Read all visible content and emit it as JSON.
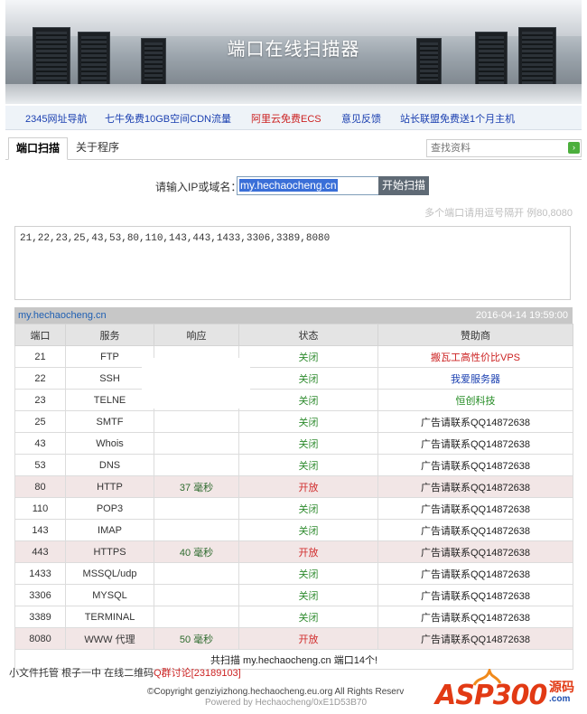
{
  "banner": {
    "title": "端口在线扫描器"
  },
  "links": [
    {
      "text": "2345网址导航",
      "color": "#1a3fb0"
    },
    {
      "text": "七牛免费10GB空间CDN流量",
      "color": "#1a3fb0"
    },
    {
      "text": "阿里云免费ECS",
      "color": "#cc2222"
    },
    {
      "text": "意见反馈",
      "color": "#1a3fb0"
    },
    {
      "text": "站长联盟免费送1个月主机",
      "color": "#1a3fb0"
    }
  ],
  "tabs": [
    {
      "label": "端口扫描",
      "active": true
    },
    {
      "label": "关于程序",
      "active": false
    }
  ],
  "search": {
    "placeholder": "查找资料"
  },
  "form": {
    "label": "请输入IP或域名：",
    "value": "my.hechaocheng.cn",
    "button": "开始扫描",
    "hint": "多个端口请用逗号隔开 例80,8080",
    "ports": "21,22,23,25,43,53,80,110,143,443,1433,3306,3389,8080"
  },
  "results": {
    "host": "my.hechaocheng.cn",
    "time": "2016-04-14 19:59:00",
    "headers": [
      "端口",
      "服务",
      "响应",
      "状态",
      "赞助商"
    ],
    "rows": [
      {
        "port": "21",
        "service": "FTP",
        "resp": "",
        "status": "关闭",
        "open": false,
        "sponsor": "搬瓦工高性价比VPS",
        "sponsor_class": "sp-red"
      },
      {
        "port": "22",
        "service": "SSH",
        "resp": "",
        "status": "关闭",
        "open": false,
        "sponsor": "我爱服务器",
        "sponsor_class": "sp-blue"
      },
      {
        "port": "23",
        "service": "TELNE",
        "resp": "",
        "status": "关闭",
        "open": false,
        "sponsor": "恒创科技",
        "sponsor_class": "sp-green"
      },
      {
        "port": "25",
        "service": "SMTF",
        "resp": "",
        "status": "关闭",
        "open": false,
        "sponsor": "广告请联系QQ14872638",
        "sponsor_class": "sp-dark"
      },
      {
        "port": "43",
        "service": "Whois",
        "resp": "",
        "status": "关闭",
        "open": false,
        "sponsor": "广告请联系QQ14872638",
        "sponsor_class": "sp-dark"
      },
      {
        "port": "53",
        "service": "DNS",
        "resp": "",
        "status": "关闭",
        "open": false,
        "sponsor": "广告请联系QQ14872638",
        "sponsor_class": "sp-dark"
      },
      {
        "port": "80",
        "service": "HTTP",
        "resp": "37 毫秒",
        "status": "开放",
        "open": true,
        "sponsor": "广告请联系QQ14872638",
        "sponsor_class": "sp-dark"
      },
      {
        "port": "110",
        "service": "POP3",
        "resp": "",
        "status": "关闭",
        "open": false,
        "sponsor": "广告请联系QQ14872638",
        "sponsor_class": "sp-dark"
      },
      {
        "port": "143",
        "service": "IMAP",
        "resp": "",
        "status": "关闭",
        "open": false,
        "sponsor": "广告请联系QQ14872638",
        "sponsor_class": "sp-dark"
      },
      {
        "port": "443",
        "service": "HTTPS",
        "resp": "40 毫秒",
        "status": "开放",
        "open": true,
        "sponsor": "广告请联系QQ14872638",
        "sponsor_class": "sp-dark"
      },
      {
        "port": "1433",
        "service": "MSSQL/udp",
        "resp": "",
        "status": "关闭",
        "open": false,
        "sponsor": "广告请联系QQ14872638",
        "sponsor_class": "sp-dark"
      },
      {
        "port": "3306",
        "service": "MYSQL",
        "resp": "",
        "status": "关闭",
        "open": false,
        "sponsor": "广告请联系QQ14872638",
        "sponsor_class": "sp-dark"
      },
      {
        "port": "3389",
        "service": "TERMINAL",
        "resp": "",
        "status": "关闭",
        "open": false,
        "sponsor": "广告请联系QQ14872638",
        "sponsor_class": "sp-dark"
      },
      {
        "port": "8080",
        "service": "WWW 代理",
        "resp": "50 毫秒",
        "status": "开放",
        "open": true,
        "sponsor": "广告请联系QQ14872638",
        "sponsor_class": "sp-dark"
      }
    ],
    "summary": "共扫描 my.hechaocheng.cn 端口14个!"
  },
  "footer": {
    "links": [
      {
        "text": "小文件托管",
        "color": "#333333"
      },
      {
        "text": "根子一中",
        "color": "#333333"
      },
      {
        "text": "在线二维码",
        "color": "#333333"
      },
      {
        "text": "Q群讨论[23189103]",
        "color": "#cc2222"
      }
    ],
    "copyright": "©Copyright genziyizhong.hechaocheng.eu.org All Rights Reserv",
    "powered": "Powered by Hechaocheng/0xE1D53B70",
    "logo_text": "ASP300",
    "logo_cn": "源码",
    "logo_domain": ".com"
  },
  "colors": {
    "open": "#d02b2b",
    "closed": "#2e8b2e",
    "accent": "#1e5fb3"
  }
}
